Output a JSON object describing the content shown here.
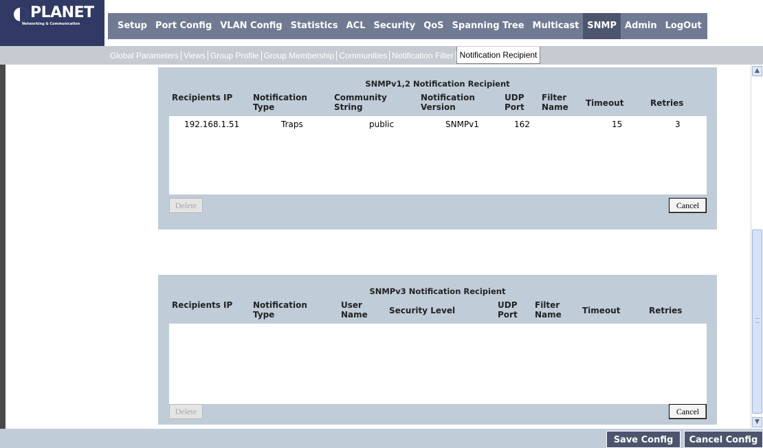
{
  "brand": {
    "logo_text": "PLANET",
    "tagline": "Networking & Communication"
  },
  "main_nav": [
    {
      "label": "Setup",
      "active": false
    },
    {
      "label": "Port Config",
      "active": false
    },
    {
      "label": "VLAN Config",
      "active": false
    },
    {
      "label": "Statistics",
      "active": false
    },
    {
      "label": "ACL",
      "active": false
    },
    {
      "label": "Security",
      "active": false
    },
    {
      "label": "QoS",
      "active": false
    },
    {
      "label": "Spanning Tree",
      "active": false
    },
    {
      "label": "Multicast",
      "active": false
    },
    {
      "label": "SNMP",
      "active": true
    },
    {
      "label": "Admin",
      "active": false
    },
    {
      "label": "LogOut",
      "active": false
    }
  ],
  "sub_nav": [
    {
      "label": "Global Parameters",
      "active": false
    },
    {
      "label": "Views",
      "active": false
    },
    {
      "label": "Group Profile",
      "active": false
    },
    {
      "label": "Group Membership",
      "active": false
    },
    {
      "label": "Communities",
      "active": false
    },
    {
      "label": "Notification Filter",
      "active": false
    },
    {
      "label": "Notification Recipient",
      "active": true
    }
  ],
  "v12": {
    "title": "SNMPv1,2 Notification Recipient",
    "headers": {
      "recipients_ip": "Recipients IP",
      "notification_type": "Notification Type",
      "community_string": "Community String",
      "notification_version": "Notification Version",
      "udp_port": "UDP Port",
      "filter_name": "Filter Name",
      "timeout": "Timeout",
      "retries": "Retries"
    },
    "rows": [
      {
        "recipients_ip": "192.168.1.51",
        "notification_type": "Traps",
        "community_string": "public",
        "notification_version": "SNMPv1",
        "udp_port": "162",
        "filter_name": "",
        "timeout": "15",
        "retries": "3"
      }
    ],
    "delete_label": "Delete",
    "cancel_label": "Cancel"
  },
  "v3": {
    "title": "SNMPv3 Notification Recipient",
    "headers": {
      "recipients_ip": "Recipients IP",
      "notification_type": "Notification Type",
      "user_name": "User Name",
      "security_level": "Security Level",
      "udp_port": "UDP Port",
      "filter_name": "Filter Name",
      "timeout": "Timeout",
      "retries": "Retries"
    },
    "rows": [],
    "delete_label": "Delete",
    "cancel_label": "Cancel"
  },
  "footer": {
    "save_label": "Save Config",
    "cancel_label": "Cancel Config"
  },
  "colors": {
    "logo_bg": "#303a64",
    "nav_bg": "#707b93",
    "nav_active_bg": "#4c556d",
    "panel_bg": "#c0ccd8"
  },
  "icons": {
    "scroll_up": "scroll-up-icon",
    "scroll_down": "scroll-down-icon"
  }
}
